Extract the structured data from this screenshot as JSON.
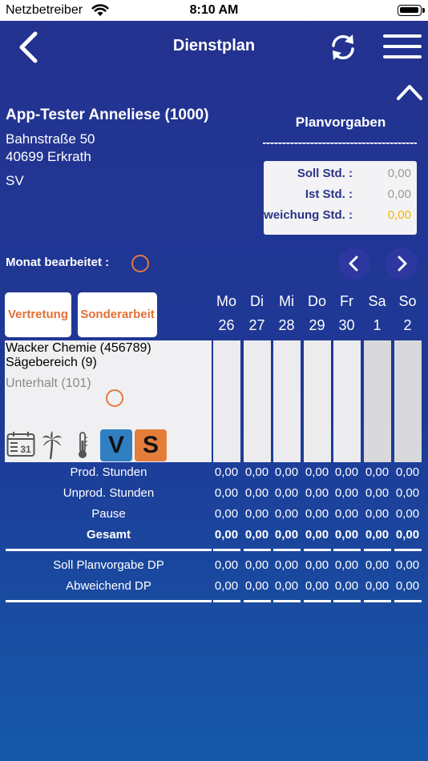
{
  "status_bar": {
    "carrier": "Netzbetreiber",
    "time": "8:10 AM"
  },
  "nav": {
    "title": "Dienstplan"
  },
  "employee": {
    "name": "App-Tester Anneliese (1000)",
    "street": "Bahnstraße 50",
    "city": "40699 Erkrath",
    "type": "SV"
  },
  "plan": {
    "title": "Planvorgaben",
    "rows": [
      {
        "label": "Soll Std. :",
        "value": "0,00",
        "highlight": false
      },
      {
        "label": "Ist Std. :",
        "value": "0,00",
        "highlight": false
      },
      {
        "label": "Abweichung Std. :",
        "value": "0,00",
        "highlight": true
      }
    ]
  },
  "month_edited_label": "Monat bearbeitet :",
  "buttons": {
    "substitution": "Vertretung",
    "special_work": "Sonderarbeit"
  },
  "days": [
    {
      "name": "Mo",
      "date": "26",
      "weekend": false
    },
    {
      "name": "Di",
      "date": "27",
      "weekend": false
    },
    {
      "name": "Mi",
      "date": "28",
      "weekend": false
    },
    {
      "name": "Do",
      "date": "29",
      "weekend": false
    },
    {
      "name": "Fr",
      "date": "30",
      "weekend": false
    },
    {
      "name": "Sa",
      "date": "1",
      "weekend": true
    },
    {
      "name": "So",
      "date": "2",
      "weekend": true
    }
  ],
  "assignment": {
    "customer": "Wacker Chemie (456789)",
    "area": "Sägebereich (9)",
    "activity": "Unterhalt (101)",
    "icons": [
      "calendar-icon",
      "palm-tree-icon",
      "thermometer-icon"
    ],
    "badges": [
      {
        "letter": "V",
        "color": "#2f7fc2"
      },
      {
        "letter": "S",
        "color": "#e57d3a"
      }
    ]
  },
  "totals": [
    {
      "label": "Prod. Stunden",
      "bold": false,
      "values": [
        "0,00",
        "0,00",
        "0,00",
        "0,00",
        "0,00",
        "0,00",
        "0,00"
      ]
    },
    {
      "label": "Unprod. Stunden",
      "bold": false,
      "values": [
        "0,00",
        "0,00",
        "0,00",
        "0,00",
        "0,00",
        "0,00",
        "0,00"
      ]
    },
    {
      "label": "Pause",
      "bold": false,
      "values": [
        "0,00",
        "0,00",
        "0,00",
        "0,00",
        "0,00",
        "0,00",
        "0,00"
      ]
    },
    {
      "label": "Gesamt",
      "bold": true,
      "values": [
        "0,00",
        "0,00",
        "0,00",
        "0,00",
        "0,00",
        "0,00",
        "0,00"
      ]
    }
  ],
  "plan_totals": [
    {
      "label": "Soll Planvorgabe DP",
      "values": [
        "0,00",
        "0,00",
        "0,00",
        "0,00",
        "0,00",
        "0,00",
        "0,00"
      ]
    },
    {
      "label": "Abweichend DP",
      "values": [
        "0,00",
        "0,00",
        "0,00",
        "0,00",
        "0,00",
        "0,00",
        "0,00"
      ]
    }
  ],
  "colors": {
    "accent_orange": "#e36f36",
    "highlight_yellow": "#f5b400",
    "label_blue": "#2a3488"
  }
}
